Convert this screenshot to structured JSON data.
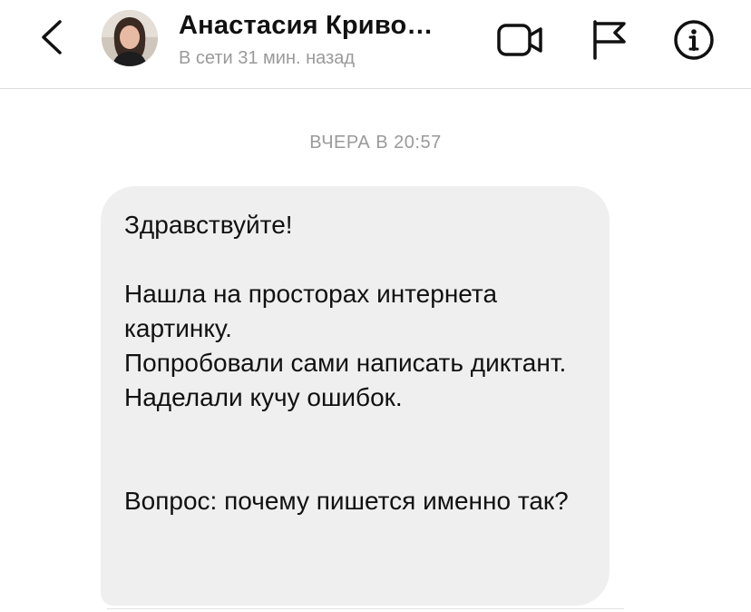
{
  "header": {
    "contact_name": "Анастасия Криво…",
    "status": "В сети 31 мин. назад",
    "icons": [
      "chevron-left-icon",
      "avatar",
      "video-camera-icon",
      "flag-icon",
      "info-icon"
    ]
  },
  "conversation": {
    "timestamp": "ВЧЕРА В 20:57",
    "message": "Здравствуйте!\n\nНашла на просторах интернета картинку.\nПопробовали сами написать диктант. Наделали кучу ошибок.\n\n\nВопрос: почему пишется именно так?"
  },
  "colors": {
    "bubble": "#efefef",
    "muted_text": "#9a9a9a",
    "divider": "#dcdcdc"
  }
}
